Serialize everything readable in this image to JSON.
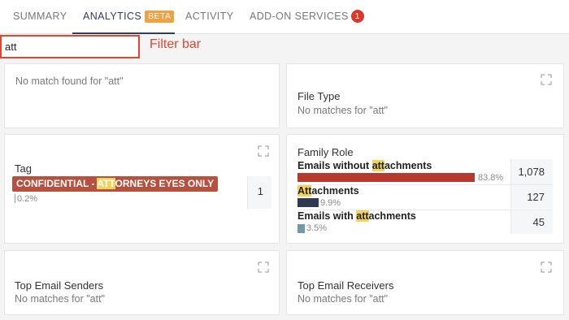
{
  "tabs": {
    "summary": "SUMMARY",
    "analytics": "ANALYTICS",
    "beta": "BETA",
    "activity": "ACTIVITY",
    "addon": "ADD-ON SERVICES",
    "addon_count": "1"
  },
  "filter": {
    "value": "att",
    "annotation": "Filter bar"
  },
  "cards": {
    "no_match": {
      "text": "No match found for \"att\""
    },
    "file_type": {
      "title": "File Type",
      "sub": "No matches for \"att\""
    },
    "tag": {
      "title": "Tag",
      "pill_before": "CONFIDENTIAL - ",
      "pill_highlight": "ATT",
      "pill_after": "ORNEYS EYES ONLY",
      "percent": "0.2%",
      "count": "1"
    },
    "family_role": {
      "title": "Family Role",
      "rows": [
        {
          "before": "Emails without ",
          "highlight": "att",
          "after": "achments",
          "percent": "83.8%",
          "count": "1,078",
          "fraction": 0.838,
          "color": "#b5392e"
        },
        {
          "before": "",
          "highlight": "Att",
          "after": "achments",
          "percent": "9.9%",
          "count": "127",
          "fraction": 0.099,
          "color": "#2d3a4f"
        },
        {
          "before": "Emails with ",
          "highlight": "att",
          "after": "achments",
          "percent": "3.5%",
          "count": "45",
          "fraction": 0.035,
          "color": "#6f9aa6"
        }
      ]
    },
    "top_senders": {
      "title": "Top Email Senders",
      "sub": "No matches for \"att\""
    },
    "top_receivers": {
      "title": "Top Email Receivers",
      "sub": "No matches for \"att\""
    }
  },
  "icons": {
    "expand": "expand-icon"
  },
  "colors": {
    "accent": "#2d3f5c",
    "beta": "#f0a140",
    "badge": "#d9392b",
    "filter_border": "#e4452f",
    "highlight": "#f2d45c",
    "tag": "#b5513e"
  }
}
